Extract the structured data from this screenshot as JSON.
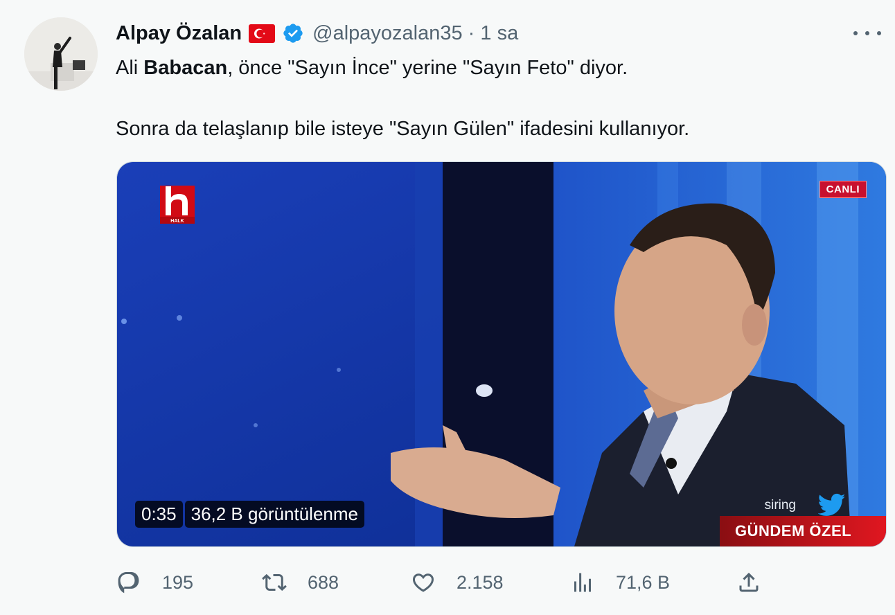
{
  "tweet": {
    "author_name": "Alpay Özalan",
    "handle_time": "@alpayozalan35 · 1 sa",
    "text_line1_prefix": "Ali ",
    "text_line1_bold": "Babacan",
    "text_line1_suffix": ", önce \"Sayın İnce\" yerine \"Sayın Feto\" diyor.",
    "text_line2": "Sonra da telaşlanıp bile isteye \"Sayın Gülen\" ifadesini kullanıyor.",
    "more_icon": "ellipsis-icon"
  },
  "video": {
    "duration": "0:35",
    "views": "36,2 B görüntülenme",
    "live_badge": "CANLI",
    "channel_logo_text": "HALK",
    "show_name": "GÜNDEM ÖZEL",
    "ticker_text": "siring"
  },
  "actions": {
    "replies": "195",
    "retweets": "688",
    "likes": "2.158",
    "views": "71,6 B"
  },
  "colors": {
    "background": "#f7f9f9",
    "text": "#0f1419",
    "secondary": "#536471",
    "verified": "#1d9bf0",
    "live_red": "#c8102e"
  }
}
